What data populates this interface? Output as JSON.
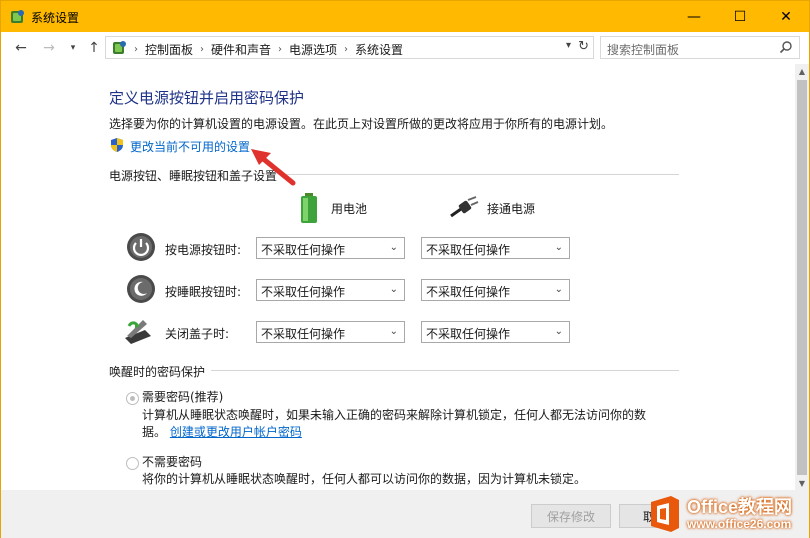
{
  "window": {
    "title": "系统设置",
    "minimize": "—",
    "maximize": "☐",
    "close": "✕"
  },
  "address": {
    "crumbs": [
      "控制面板",
      "硬件和声音",
      "电源选项",
      "系统设置"
    ],
    "search_placeholder": "搜索控制面板"
  },
  "content": {
    "heading": "定义电源按钮并启用密码保护",
    "description": "选择要为你的计算机设置的电源设置。在此页上对设置所做的更改将应用于你所有的电源计划。",
    "change_link": "更改当前不可用的设置",
    "power_section_label": "电源按钮、睡眠按钮和盖子设置",
    "col_battery": "用电池",
    "col_plugged": "接通电源",
    "rows": [
      {
        "label": "按电源按钮时:",
        "battery": "不采取任何操作",
        "plugged": "不采取任何操作"
      },
      {
        "label": "按睡眠按钮时:",
        "battery": "不采取任何操作",
        "plugged": "不采取任何操作"
      },
      {
        "label": "关闭盖子时:",
        "battery": "不采取任何操作",
        "plugged": "不采取任何操作"
      }
    ],
    "password_section_label": "唤醒时的密码保护",
    "require_label": "需要密码(推荐)",
    "require_desc_line1": "计算机从睡眠状态唤醒时，如果未输入正确的密码来解除计算机锁定，任何人都无法访问你的数",
    "require_desc_line2_prefix": "据。",
    "require_desc_link": "创建或更改用户帐户密码",
    "no_require_label": "不需要密码",
    "no_require_desc": "将你的计算机从睡眠状态唤醒时，任何人都可以访问你的数据，因为计算机未锁定。"
  },
  "footer": {
    "save_button": "保存修改",
    "cancel_button": "取"
  },
  "watermark": {
    "brand": "Office教程网",
    "url": "www.office26.com"
  },
  "colors": {
    "titlebar": "#ffb900",
    "heading": "#1e3287",
    "link": "#0066cc"
  }
}
